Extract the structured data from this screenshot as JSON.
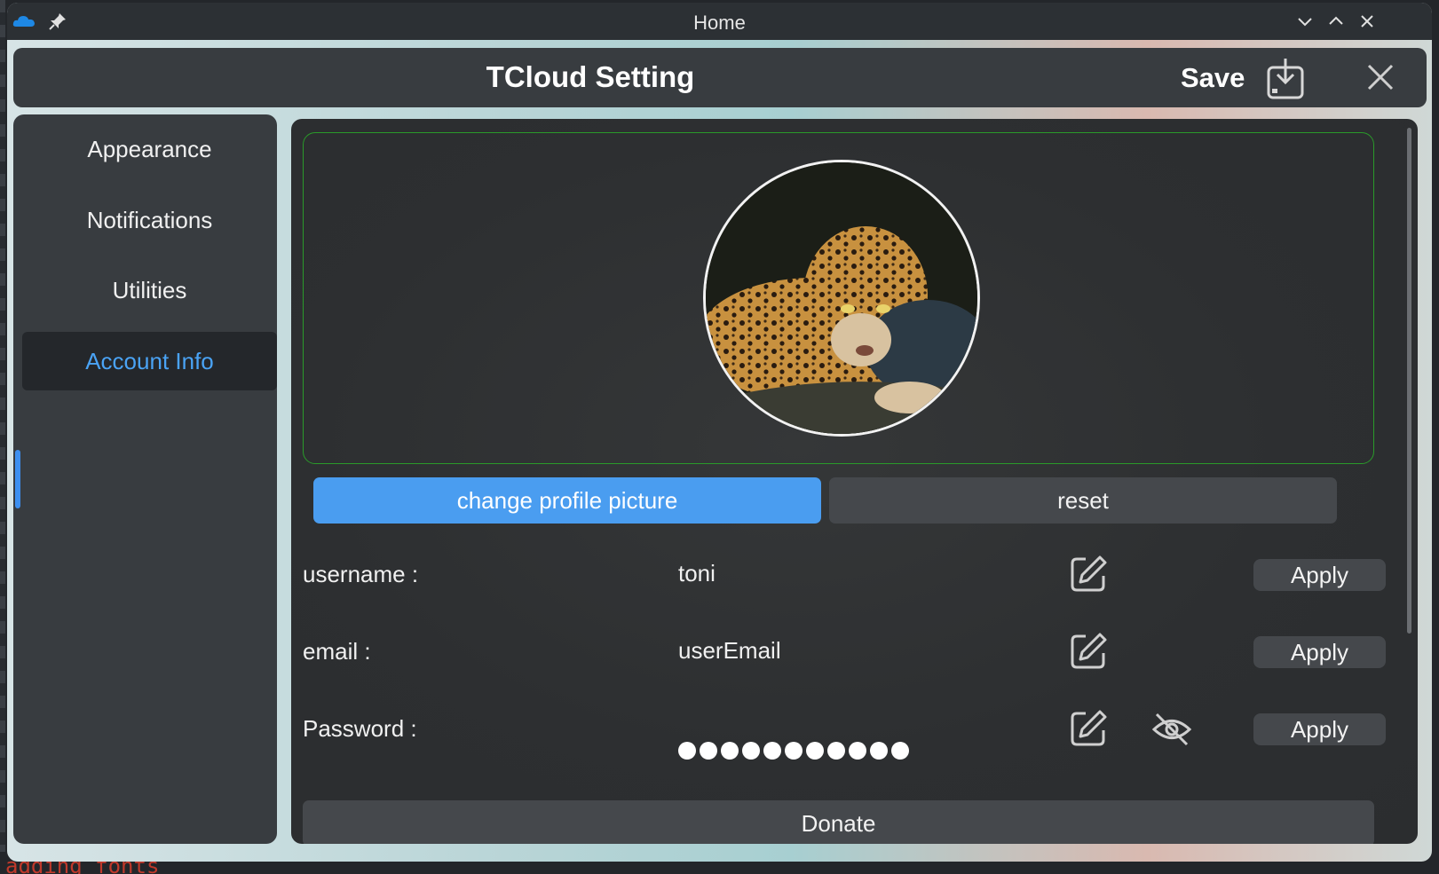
{
  "window": {
    "title": "Home"
  },
  "header": {
    "title": "TCloud Setting",
    "save_label": "Save"
  },
  "sidebar": {
    "items": [
      {
        "label": "Appearance",
        "active": false
      },
      {
        "label": "Notifications",
        "active": false
      },
      {
        "label": "Utilities",
        "active": false
      },
      {
        "label": "Account Info",
        "active": true
      }
    ]
  },
  "profile": {
    "change_picture_label": "change profile picture",
    "reset_label": "reset"
  },
  "fields": {
    "username": {
      "label": "username :",
      "value": "toni",
      "apply_label": "Apply"
    },
    "email": {
      "label": "email :",
      "value": "userEmail",
      "apply_label": "Apply"
    },
    "password": {
      "label": "Password :",
      "masked_length": 11,
      "apply_label": "Apply"
    }
  },
  "donate_label": "Donate",
  "background_terminal_text": "adding fonts",
  "colors": {
    "accent": "#4a9df0",
    "active_nav_text": "#4aa3f5",
    "avatar_frame_border": "#2a9a2a"
  },
  "icons": {
    "titlebar": [
      "cloud-icon",
      "pin-icon",
      "minimize-icon",
      "maximize-icon",
      "close-icon"
    ],
    "header": [
      "save-icon",
      "close-icon"
    ],
    "fields": [
      "edit-icon",
      "eye-off-icon"
    ]
  }
}
